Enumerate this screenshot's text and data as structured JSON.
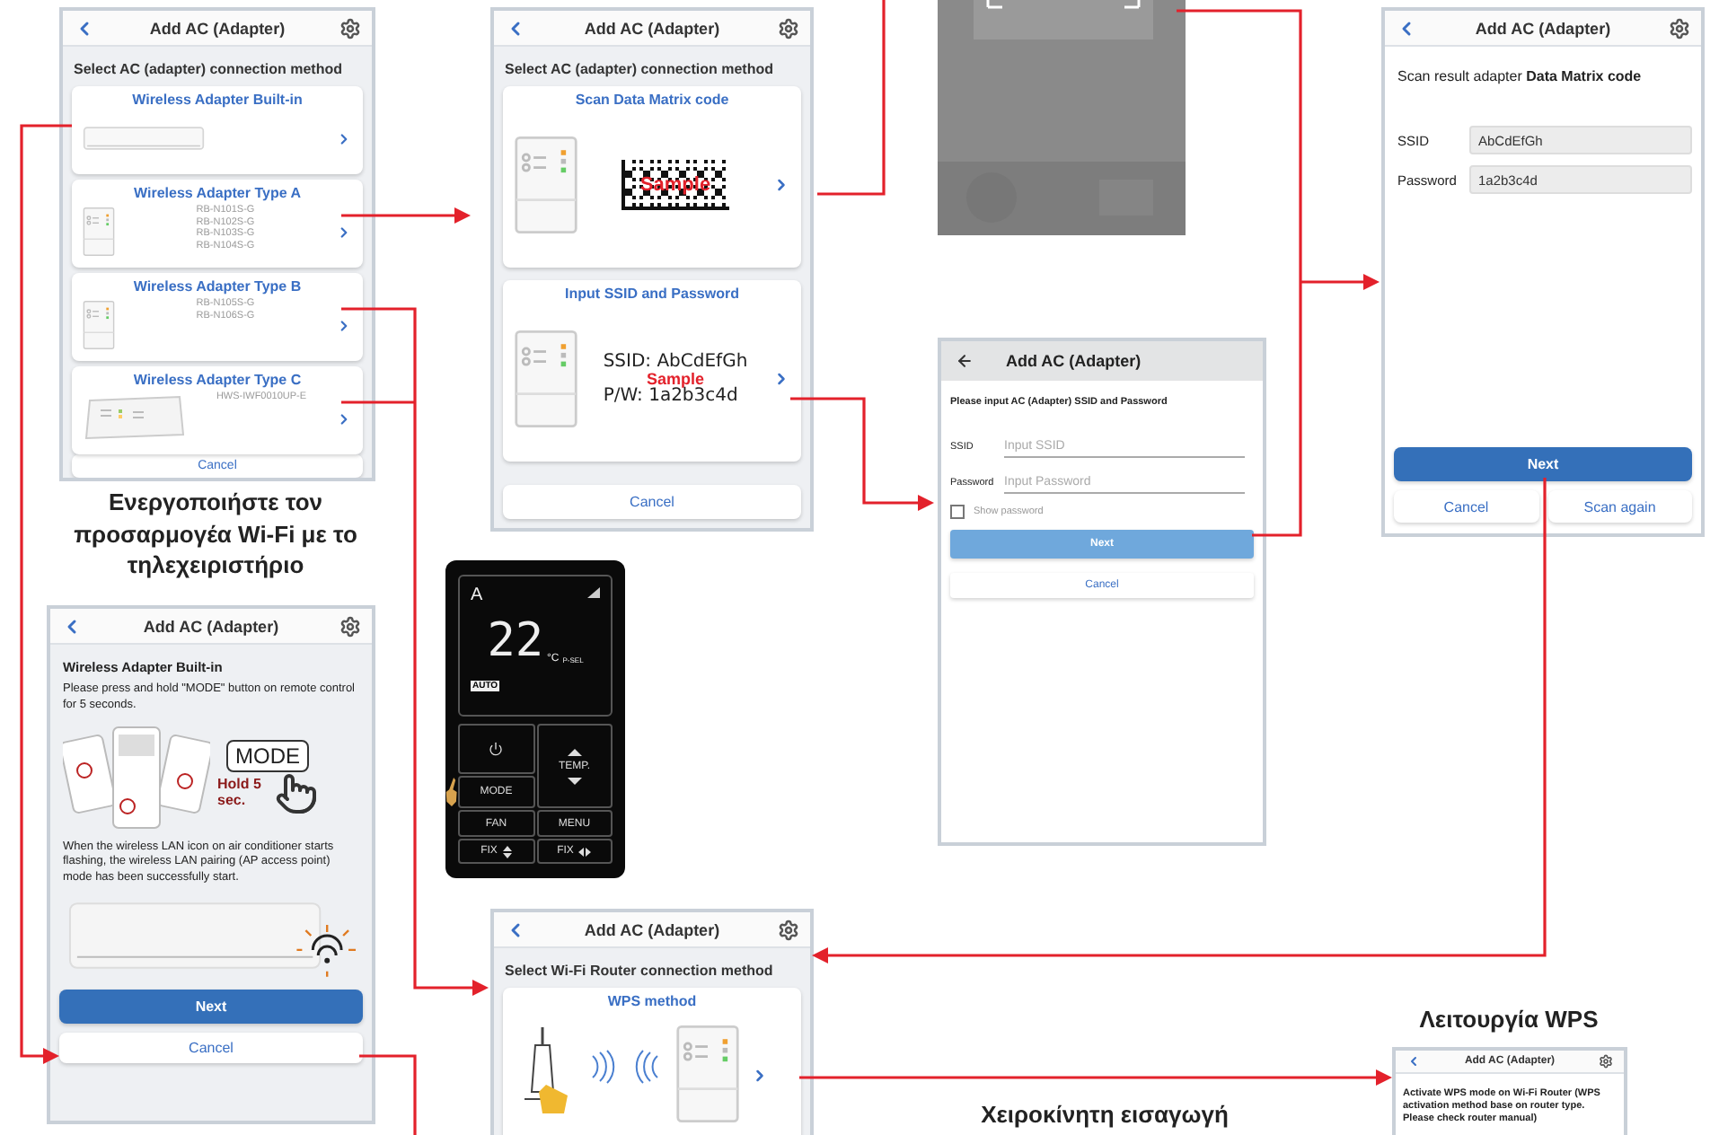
{
  "adapter_select": {
    "title": "Add AC (Adapter)",
    "subtitle": "Select AC (adapter) connection method",
    "options": [
      {
        "kind": "builtin",
        "title": "Wireless Adapter Built-in"
      },
      {
        "kind": "adapter",
        "title": "Wireless Adapter Type A",
        "models": [
          "RB-N101S-G",
          "RB-N102S-G",
          "RB-N103S-G",
          "RB-N104S-G"
        ]
      },
      {
        "kind": "adapter",
        "title": "Wireless Adapter Type B",
        "models": [
          "RB-N105S-G",
          "RB-N106S-G"
        ]
      },
      {
        "kind": "box",
        "title": "Wireless Adapter Type C",
        "models": [
          "HWS-IWF0010UP-E"
        ]
      }
    ],
    "cancel": "Cancel"
  },
  "caption_remote": "Ενεργοποιήστε τον προσαρμογέα Wi-Fi με το τηλεχειριστήριο",
  "method_select": {
    "title": "Add AC (Adapter)",
    "subtitle": "Select AC (adapter) connection method",
    "options": [
      {
        "kind": "matrix",
        "title": "Scan Data Matrix code",
        "sample": "Sample"
      },
      {
        "kind": "credentials",
        "title": "Input SSID and Password",
        "lines": [
          "SSID: AbCdEfGh",
          "P/W: 1a2b3c4d"
        ],
        "sample": "Sample"
      }
    ],
    "cancel": "Cancel"
  },
  "ssid_input": {
    "title": "Add AC (Adapter)",
    "prompt": "Please input AC (Adapter) SSID and Password",
    "fields": [
      {
        "label": "SSID",
        "placeholder": "Input SSID"
      },
      {
        "label": "Password",
        "placeholder": "Input Password"
      }
    ],
    "show_password": {
      "label": "Show password",
      "checked": false
    },
    "next": {
      "label": "Next",
      "disabled": true
    },
    "cancel": "Cancel"
  },
  "scan_result": {
    "title": "Add AC (Adapter)",
    "heading": "Scan result  adapter **Data Matrix code**",
    "fields": [
      {
        "label": "SSID",
        "value": "AbCdEfGh"
      },
      {
        "label": "Password",
        "value": "1a2b3c4d"
      }
    ],
    "next": "Next",
    "cancel": "Cancel",
    "scan_again": "Scan again"
  },
  "remote": {
    "mode_letter": "A",
    "temperature": "22",
    "unit": "°C",
    "preset": "P-SEL",
    "auto": "AUTO",
    "buttons": [
      {
        "kind": "power"
      },
      {
        "kind": "temp",
        "label": "TEMP."
      },
      {
        "kind": "text",
        "label": "MODE"
      },
      {
        "kind": "text",
        "label": "FAN"
      },
      {
        "kind": "text",
        "label": "MENU"
      },
      {
        "kind": "fix_v",
        "label": "FIX"
      },
      {
        "kind": "fix_h",
        "label": "FIX"
      }
    ]
  },
  "builtin_instruction": {
    "title": "Add AC (Adapter)",
    "heading": "Wireless Adapter Built-in",
    "text": "Please press and hold \"MODE\" button on remote control for 5 seconds.",
    "key_label": "MODE",
    "hold": "Hold 5 sec.",
    "result_text": "When the wireless LAN icon on air conditioner starts flashing, the wireless LAN pairing (AP access point) mode has been successfully start.",
    "next": "Next",
    "cancel": "Cancel"
  },
  "router_select": {
    "title": "Add AC (Adapter)",
    "subtitle": "Select Wi-Fi Router connection method",
    "options": [
      {
        "title": "WPS method"
      }
    ]
  },
  "caption_wps": "Λειτουργία WPS",
  "wps_screen": {
    "title": "Add AC (Adapter)",
    "text": "Activate WPS mode on Wi-Fi Router (WPS activation method base on router type. Please check router manual)"
  },
  "caption_manual": "Χειροκίνητη εισαγωγή"
}
